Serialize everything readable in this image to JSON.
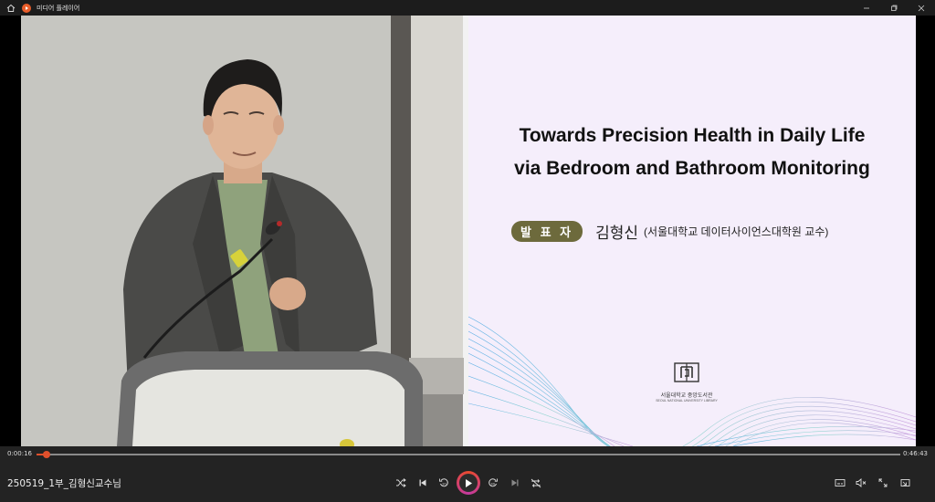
{
  "window": {
    "title": "미디어 플레이어",
    "icons": [
      "home-icon",
      "app-icon",
      "minimize-icon",
      "restore-icon",
      "close-icon"
    ]
  },
  "slide": {
    "title_line1": "Towards Precision Health in Daily Life",
    "title_line2": "via Bedroom and Bathroom Monitoring",
    "presenter_badge": "발 표 자",
    "presenter_name": "김형신",
    "presenter_affiliation": "(서울대학교 데이터사이언스대학원 교수)",
    "logo_korean": "서울대학교 중앙도서관",
    "logo_english": "SEOUL NATIONAL UNIVERSITY LIBRARY"
  },
  "player": {
    "current_time": "0:00:16",
    "total_time": "0:46:43",
    "progress": 0.0057,
    "file_name": "250519_1부_김형신교수님",
    "accent_color": "#e0502c"
  },
  "controls": {
    "icons": [
      "shuffle-icon",
      "previous-icon",
      "rewind-10-icon",
      "play-icon",
      "forward-30-icon",
      "next-icon",
      "repeat-off-icon",
      "subtitles-icon",
      "volume-muted-icon",
      "fullscreen-icon",
      "miniplayer-icon"
    ]
  }
}
